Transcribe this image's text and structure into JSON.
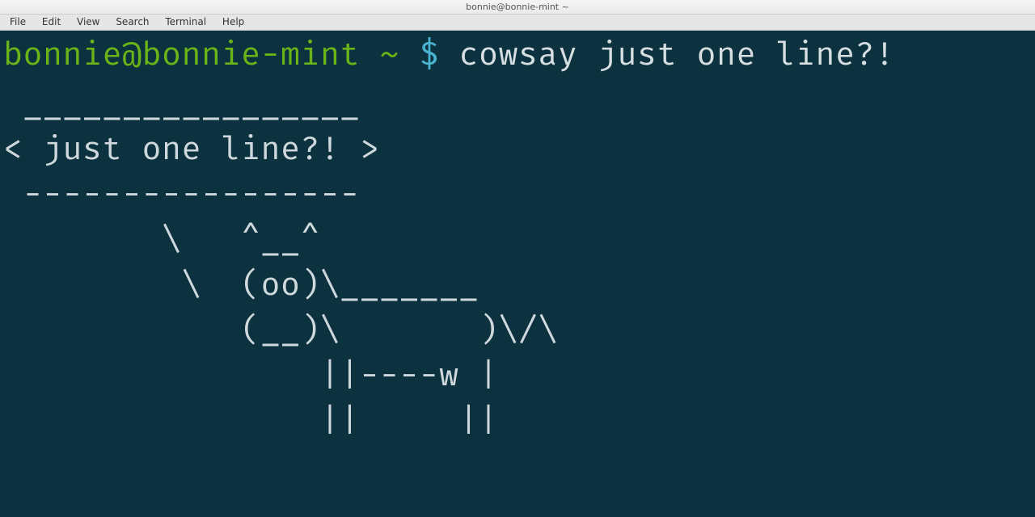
{
  "window": {
    "title": "bonnie@bonnie-mint ~"
  },
  "menu": {
    "items": [
      "File",
      "Edit",
      "View",
      "Search",
      "Terminal",
      "Help"
    ]
  },
  "terminal": {
    "prompt_user_host": "bonnie@bonnie-mint",
    "prompt_cwd": "~",
    "prompt_symbol": "$",
    "command": "cowsay just one line?!",
    "output_lines": [
      " _________________ ",
      "< just one line?! >",
      " ----------------- ",
      "        \\   ^__^",
      "         \\  (oo)\\_______",
      "            (__)\\       )\\/\\",
      "                ||----w |",
      "                ||     ||"
    ]
  },
  "colors": {
    "bg": "#0b323e",
    "fg": "#d6dee2",
    "prompt_green": "#6ab417",
    "prompt_cyan": "#4ab3d1"
  }
}
